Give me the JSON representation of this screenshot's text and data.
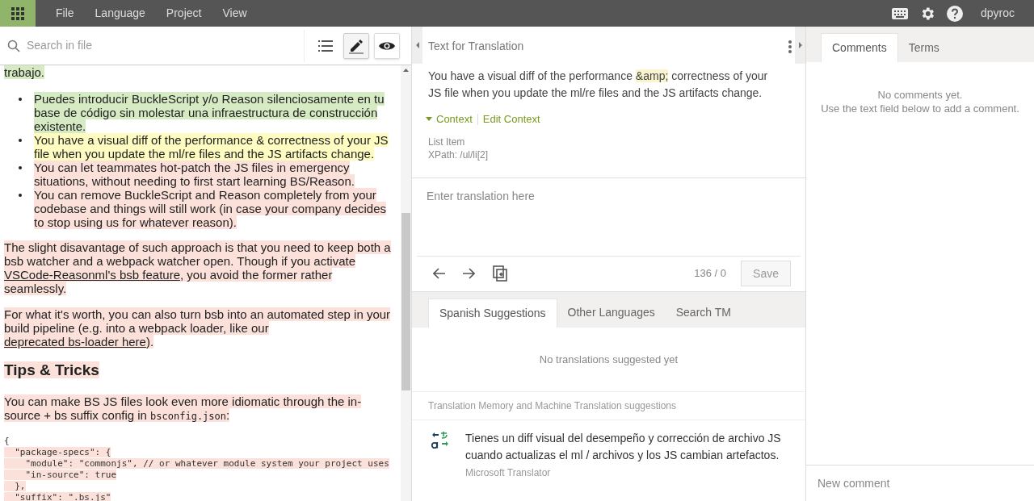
{
  "menu": {
    "items": [
      "File",
      "Language",
      "Project",
      "View"
    ],
    "user": "dpyroc"
  },
  "editor": {
    "search_placeholder": "Search in file",
    "views": [
      {
        "kind": "list",
        "selected": false
      },
      {
        "kind": "edit",
        "selected": true
      },
      {
        "kind": "preview",
        "selected": false
      }
    ],
    "blocks": [
      {
        "kind": "paragraph",
        "color": "#d6ebc3",
        "segments": [
          {
            "text": "trabajo."
          }
        ]
      },
      {
        "kind": "list",
        "items": [
          {
            "color": "#d6ebc3",
            "text": "Puedes introducir BuckleScript y/o Reason silenciosamente en tu base de código sin molestar una infraestructura de construcción existente."
          },
          {
            "color": "#fefcc0",
            "text": "You have a visual diff of the performance & correctness of your JS file when you update the ml/re files and the JS artifacts change."
          },
          {
            "color": "#fbe1da",
            "text": "You can let teammates hot-patch the JS files in emergency situations, without needing to first start learning BS/Reason."
          },
          {
            "color": "#fbe1da",
            "text": "You can remove BuckleScript and Reason completely from your codebase and things will still work (in case your company decides to stop using us for whatever reason)."
          }
        ]
      },
      {
        "kind": "paragraph",
        "color": "#fbe1da",
        "segments": [
          {
            "text": "The slight disavantage of such approach is that you need to keep both a bsb watcher and a webpack watcher open. Though if you activate "
          },
          {
            "link": "VSCode-Reasonml's bsb feature"
          },
          {
            "text": ", you avoid the former rather seamlessly."
          }
        ]
      },
      {
        "kind": "paragraph",
        "color": "#fbe1da",
        "segments": [
          {
            "text": "For what it's worth, you can also turn bsb into an automated step in your build pipeline (e.g. into a webpack loader, like our "
          },
          {
            "link": "deprecated bs-loader here"
          },
          {
            "text": ")."
          }
        ]
      },
      {
        "kind": "heading",
        "color": "#fbe1da",
        "segments": [
          {
            "text": "Tips & Tricks"
          }
        ]
      },
      {
        "kind": "paragraph",
        "color": "#fbe1da",
        "segments": [
          {
            "text": "You can make BS JS files look even more idiomatic through the in-source + bs suffix config in "
          },
          {
            "code": "bsconfig.json"
          },
          {
            "text": ":"
          }
        ]
      },
      {
        "kind": "code",
        "color": "#fbe1da",
        "lines": [
          "{",
          "  \"package-specs\": {",
          "    \"module\": \"commonjs\", // or whatever module system your project uses",
          "    \"in-source\": true",
          "  },",
          "  \"suffix\": \".bs.js\""
        ]
      }
    ]
  },
  "source": {
    "title": "Text for Translation",
    "text": "You have a visual diff of the performance **&amp;** correctness of your JS file when you update the ml/re files and the JS artifacts change.",
    "context_label": "Context",
    "context_expanded": true,
    "edit_context": "Edit Context",
    "context_lines": [
      "List Item",
      "XPath: /ul/li[2]"
    ]
  },
  "translation": {
    "placeholder": "Enter translation here",
    "count": "136 / 0",
    "save": "Save"
  },
  "suggestions": {
    "tabs": [
      {
        "label": "Spanish Suggestions",
        "selected": true
      },
      {
        "label": "Other Languages",
        "selected": false
      },
      {
        "label": "Search TM",
        "selected": false
      }
    ],
    "empty": "No translations suggested yet",
    "section": "Translation Memory and Machine Translation suggestions",
    "items": [
      {
        "text": "Tienes un diff visual del desempeño y corrección de archivo JS cuando actualizas el ml / archivos y los JS cambian artefactos.",
        "source": "Microsoft Translator"
      }
    ]
  },
  "comments": {
    "tabs": [
      {
        "label": "Comments",
        "selected": true
      },
      {
        "label": "Terms",
        "selected": false
      }
    ],
    "empty": [
      "No comments yet.",
      "Use the text field below to add a comment."
    ],
    "placeholder": "New comment"
  }
}
